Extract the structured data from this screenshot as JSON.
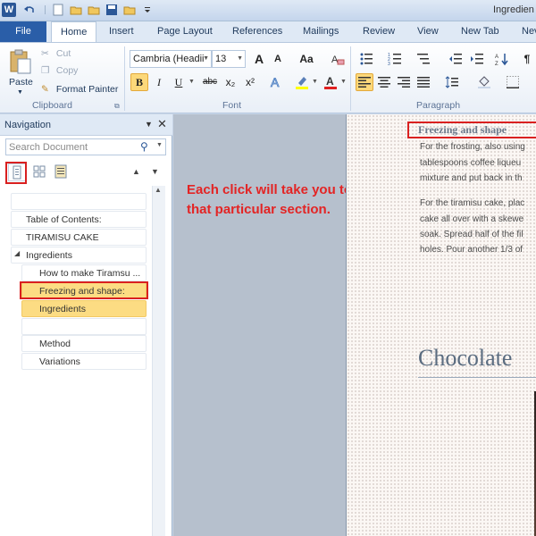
{
  "app": {
    "title": "Ingredien",
    "logo_letter": "W"
  },
  "tabs": [
    {
      "label": "File"
    },
    {
      "label": "Home"
    },
    {
      "label": "Insert"
    },
    {
      "label": "Page Layout"
    },
    {
      "label": "References"
    },
    {
      "label": "Mailings"
    },
    {
      "label": "Review"
    },
    {
      "label": "View"
    },
    {
      "label": "New Tab"
    },
    {
      "label": "Nev"
    }
  ],
  "ribbon": {
    "clipboard": {
      "paste_label": "Paste",
      "cut_label": "Cut",
      "copy_label": "Copy",
      "format_painter_label": "Format Painter",
      "group_label": "Clipboard"
    },
    "font": {
      "font_name": "Cambria (Headii",
      "font_size": "13",
      "group_label": "Font",
      "bold": "B",
      "italic": "I",
      "underline": "U",
      "strike": "abc",
      "subscript": "x₂",
      "superscript": "x²",
      "grow": "A",
      "shrink": "A",
      "change_case": "Aa"
    },
    "paragraph": {
      "group_label": "Paragraph",
      "pilcrow": "¶"
    }
  },
  "navigation": {
    "title": "Navigation",
    "search_placeholder": "Search Document",
    "items": [
      {
        "label": ""
      },
      {
        "label": "Table of Contents:"
      },
      {
        "label": "TIRAMISU CAKE"
      },
      {
        "label": "Ingredients"
      },
      {
        "label": "How to make Tiramsu ..."
      },
      {
        "label": "Freezing and shape:"
      },
      {
        "label": "Ingredients"
      },
      {
        "label": ""
      },
      {
        "label": "Method"
      },
      {
        "label": "Variations"
      }
    ],
    "expand_glyph": "◢"
  },
  "annotation": {
    "text": "Each click will take you to that particular section."
  },
  "document": {
    "heading": "Freezing and shape",
    "lines": [
      "For the frosting, also using",
      "tablespoons coffee liqueu",
      "mixture and put back in th",
      "For the tiramisu cake, plac",
      "cake all over with a skewe",
      "soak. Spread half of the fil",
      "holes. Pour another 1/3 of"
    ],
    "section_heading": "Chocolate"
  },
  "colors": {
    "file_tab": "#2a5ea8",
    "highlight": "#fcdc83",
    "annotation_red": "#e32424",
    "callout_border": "#d92020"
  }
}
